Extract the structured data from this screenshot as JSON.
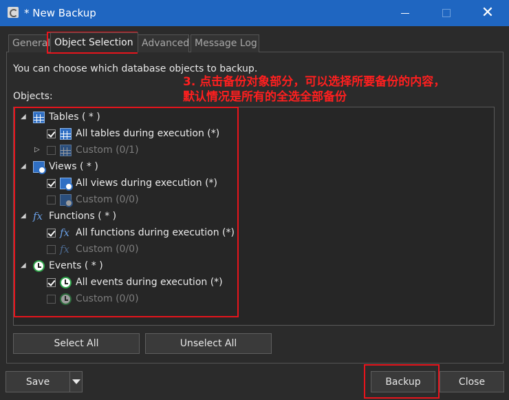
{
  "window": {
    "title": "* New Backup"
  },
  "tabs": [
    {
      "label": "General"
    },
    {
      "label": "Object Selection"
    },
    {
      "label": "Advanced"
    },
    {
      "label": "Message Log"
    }
  ],
  "intro_text": "You can choose which database objects to backup.",
  "objects_label": "Objects:",
  "tree": {
    "tables": {
      "label": "Tables ( * )",
      "all": "All tables during execution (*)",
      "custom": "Custom (0/1)"
    },
    "views": {
      "label": "Views ( * )",
      "all": "All views during execution (*)",
      "custom": "Custom (0/0)"
    },
    "functions": {
      "label": "Functions ( * )",
      "all": "All functions during execution (*)",
      "custom": "Custom (0/0)"
    },
    "events": {
      "label": "Events ( * )",
      "all": "All events during execution (*)",
      "custom": "Custom (0/0)"
    }
  },
  "annotation": {
    "line1": "3. 点击备份对象部分，可以选择所要备份的内容，",
    "line2": "默认情况是所有的全选全部备份",
    "color": "#e8141c"
  },
  "buttons": {
    "select_all": "Select All",
    "unselect_all": "Unselect All",
    "save": "Save",
    "backup": "Backup",
    "close": "Close"
  },
  "colors": {
    "titlebar": "#1f66c1",
    "background": "#2b2b2b",
    "accent_table_icon": "#2f6fc4",
    "event_icon": "#2fa34a"
  }
}
